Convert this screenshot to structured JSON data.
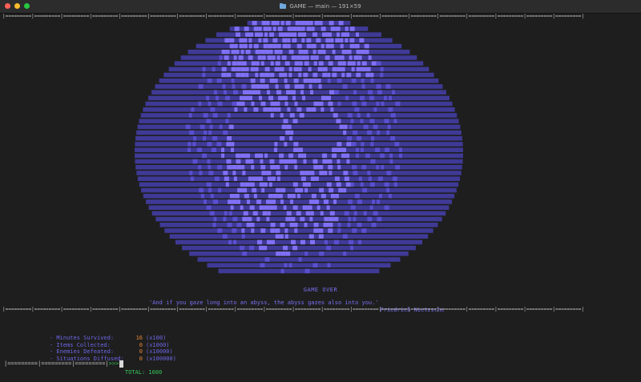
{
  "window": {
    "title": "GAME — main — 191×59",
    "folder_icon": "folder-icon",
    "controls": [
      "close-icon",
      "minimize-icon",
      "zoom-icon"
    ]
  },
  "divider_segment": "|=========",
  "game": {
    "heading": "GAME OVER",
    "quote": "'And if you gaze long into an abyss, the abyss gazes also into you.'",
    "author": "- Friedrich Nietzsche",
    "stats": [
      {
        "label": "- Minutes Survived:",
        "value": "16",
        "multiplier": "(x100)"
      },
      {
        "label": "- Items Collected:",
        "value": "0",
        "multiplier": "(x1000)"
      },
      {
        "label": "- Enemies Defeated:",
        "value": "0",
        "multiplier": "(x10000)"
      },
      {
        "label": "- Situations Diffused:",
        "value": "0",
        "multiplier": "(x100000)"
      }
    ],
    "total_label": "TOTAL:",
    "total_value": "1600"
  },
  "prompt": {
    "bar": "|=========|=========|=========|",
    "symbol": ">>>"
  },
  "colors": {
    "art_dark": "#3f3a96",
    "art_mid": "#5a4fd0",
    "art_light": "#8070f5",
    "text_accent": "#7a6ff2",
    "value": "#e8883a",
    "total": "#34c759"
  }
}
